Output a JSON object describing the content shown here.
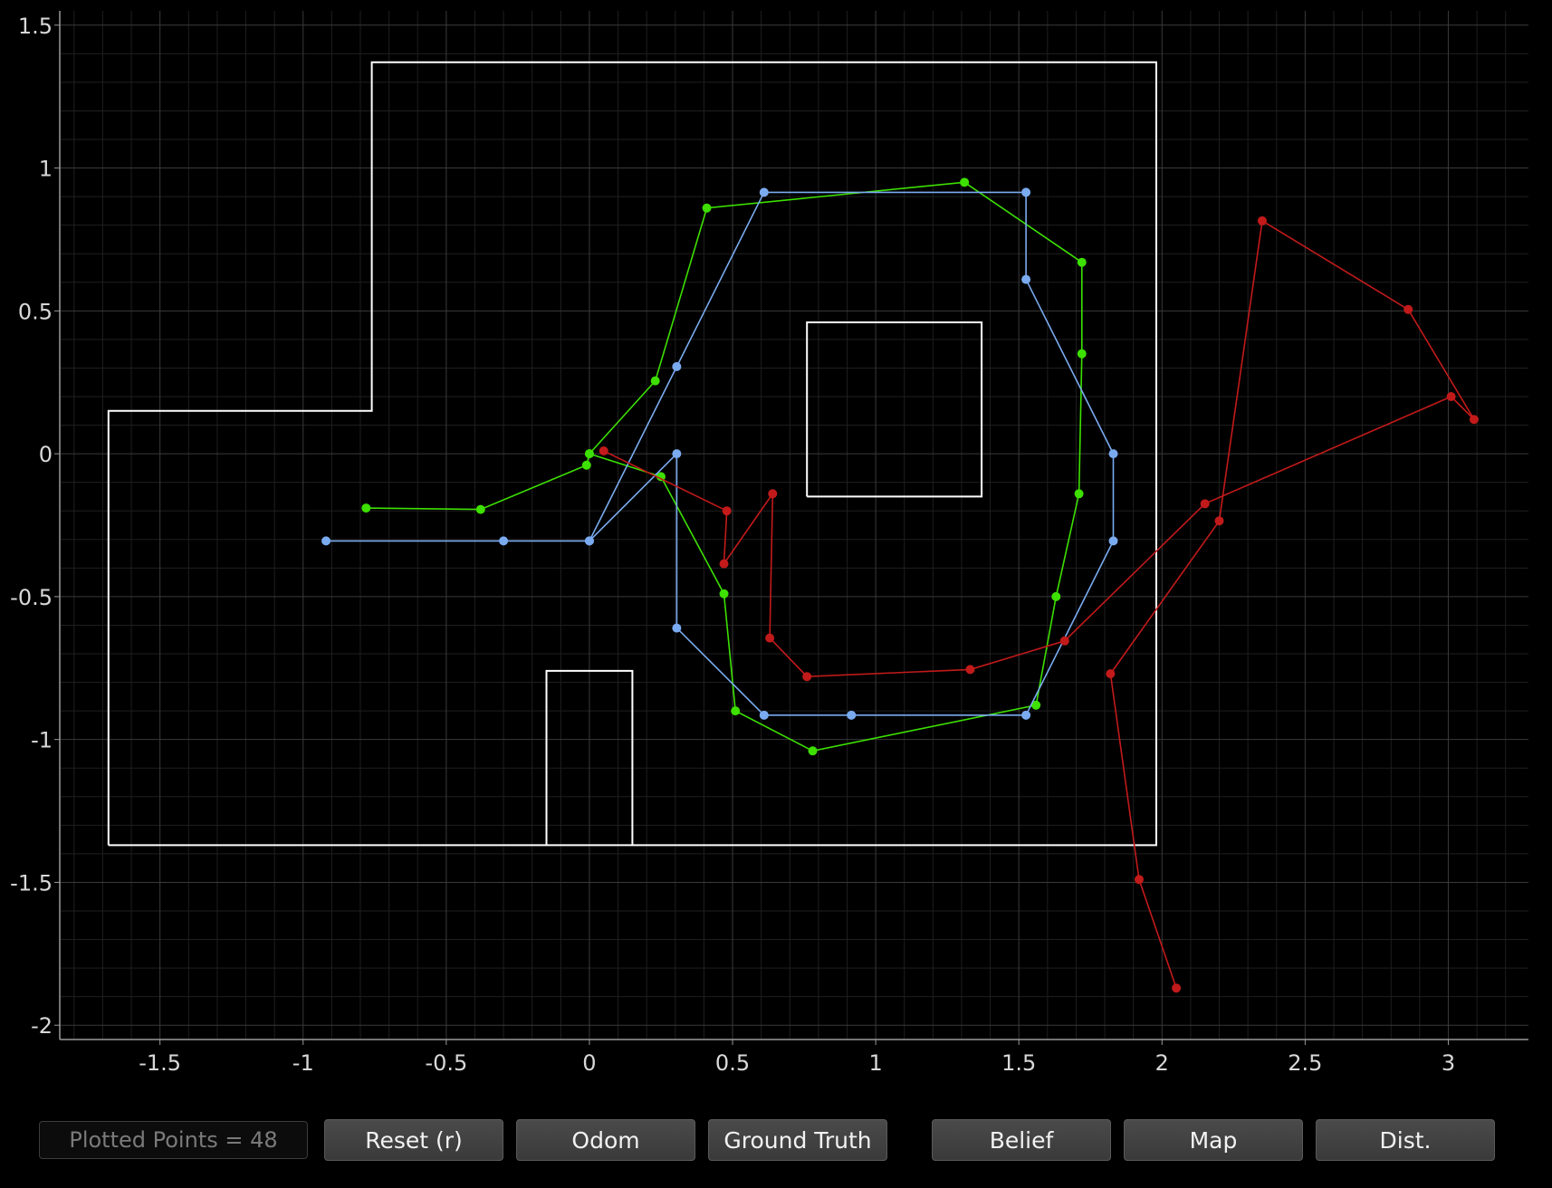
{
  "chart_data": {
    "type": "line",
    "title": "",
    "xlabel": "",
    "ylabel": "",
    "xlim": [
      -1.85,
      3.28
    ],
    "ylim": [
      -2.05,
      1.55
    ],
    "grid": true,
    "xticks": [
      -1.5,
      -1,
      -0.5,
      0,
      0.5,
      1,
      1.5,
      2,
      2.5,
      3
    ],
    "yticks": [
      -2,
      -1.5,
      -1,
      -0.5,
      0,
      0.5,
      1,
      1.5
    ],
    "xtick_labels": [
      "-1.5",
      "-1",
      "-0.5",
      "0",
      "0.5",
      "1",
      "1.5",
      "2",
      "2.5",
      "3"
    ],
    "ytick_labels": [
      "-2",
      "-1.5",
      "-1",
      "-0.5",
      "0",
      "0.5",
      "1",
      "1.5"
    ],
    "map": [
      {
        "points": [
          [
            -1.68,
            -1.37
          ],
          [
            1.98,
            -1.37
          ],
          [
            1.98,
            1.37
          ],
          [
            -0.76,
            1.37
          ],
          [
            -0.76,
            0.15
          ],
          [
            -1.68,
            0.15
          ],
          [
            -1.68,
            -1.37
          ]
        ]
      },
      {
        "points": [
          [
            0.76,
            -0.15
          ],
          [
            1.37,
            -0.15
          ],
          [
            1.37,
            0.46
          ],
          [
            0.76,
            0.46
          ],
          [
            0.76,
            -0.15
          ]
        ]
      },
      {
        "points": [
          [
            -0.15,
            -1.37
          ],
          [
            -0.15,
            -0.76
          ],
          [
            0.15,
            -0.76
          ],
          [
            0.15,
            -1.37
          ]
        ]
      }
    ],
    "series": [
      {
        "color": "#3de000",
        "x": [
          -0.78,
          -0.38,
          -0.01,
          0,
          0.25,
          0.47,
          0.51,
          0.78,
          1.56,
          1.63,
          1.71,
          1.72,
          1.72,
          1.31,
          0.41,
          0.23,
          0
        ],
        "y": [
          -0.19,
          -0.195,
          -0.04,
          0,
          -0.08,
          -0.49,
          -0.9,
          -1.04,
          -0.88,
          -0.5,
          -0.14,
          0.35,
          0.67,
          0.95,
          0.86,
          0.255,
          0
        ]
      },
      {
        "color": "#7aabf0",
        "x": [
          -0.92,
          -0.3,
          0,
          0.305,
          0.305,
          0.61,
          0.915,
          1.525,
          1.83,
          1.83,
          1.525,
          1.525,
          0.61,
          0.305,
          0
        ],
        "y": [
          -0.305,
          -0.305,
          -0.305,
          0,
          -0.61,
          -0.915,
          -0.915,
          -0.915,
          -0.305,
          0,
          0.61,
          0.915,
          0.915,
          0.305,
          -0.305
        ]
      },
      {
        "color": "#c21a1a",
        "x": [
          0.05,
          0.48,
          0.47,
          0.64,
          0.63,
          0.76,
          1.33,
          1.66,
          2.15,
          3.01,
          3.09,
          2.86,
          2.35,
          2.2,
          1.82,
          1.92,
          2.05
        ],
        "y": [
          0.01,
          -0.2,
          -0.385,
          -0.14,
          -0.645,
          -0.78,
          -0.755,
          -0.655,
          -0.175,
          0.2,
          0.12,
          0.505,
          0.815,
          -0.235,
          -0.77,
          -1.49,
          -1.87
        ]
      }
    ]
  },
  "toolbar": {
    "points_label": "Plotted Points = 48",
    "reset_label": "Reset (r)",
    "odom_label": "Odom",
    "gt_label": "Ground Truth",
    "belief_label": "Belief",
    "map_label": "Map",
    "dist_label": "Dist."
  }
}
